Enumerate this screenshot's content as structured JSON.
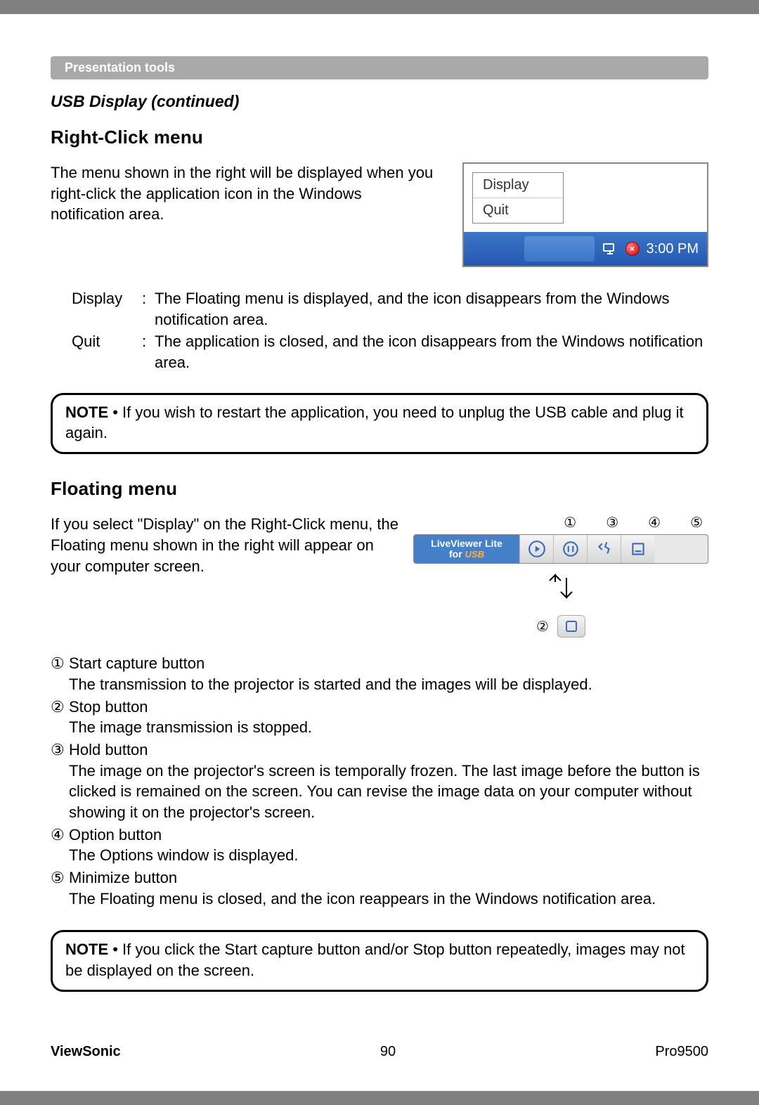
{
  "section_bar": "Presentation tools",
  "subtitle": "USB Display (continued)",
  "h1": "Right-Click menu",
  "p1": "The menu shown in the right will be displayed when you right-click the application icon in the Windows notification area.",
  "rc_menu": {
    "display": "Display",
    "quit": "Quit",
    "time": "3:00 PM"
  },
  "defs": {
    "display_term": "Display",
    "display_desc": "The Floating menu is displayed, and the icon disappears from the Windows notification area.",
    "quit_term": "Quit",
    "quit_desc": "The application is closed, and the icon disappears from the Windows notification area."
  },
  "note1_label": "NOTE",
  "note1_text": "  • If you wish to restart the application, you need to unplug the USB cable and plug it again.",
  "h2": "Floating menu",
  "p2": "If you select \"Display\" on the Right-Click menu, the Floating menu shown in the right will appear on your computer screen.",
  "callouts": {
    "c1": "①",
    "c3": "③",
    "c4": "④",
    "c5": "⑤",
    "c2": "②"
  },
  "lv_logo_line1": "LiveViewer Lite",
  "lv_logo_line2_a": "for ",
  "lv_logo_line2_b": "USB",
  "items": {
    "i1_mark": "①",
    "i1_title": "Start capture button",
    "i1_desc": "The transmission to the projector is started and the images will be displayed.",
    "i2_mark": "②",
    "i2_title": "Stop button",
    "i2_desc": "The image transmission is stopped.",
    "i3_mark": "③",
    "i3_title": "Hold button",
    "i3_desc": "The image on the projector's screen is temporally frozen. The last image before the button is clicked is remained on the screen. You can revise the image data on your computer without showing it on the projector's screen.",
    "i4_mark": "④",
    "i4_title": "Option button",
    "i4_desc": "The Options window is displayed.",
    "i5_mark": "⑤",
    "i5_title": "Minimize button",
    "i5_desc": "The Floating menu is closed, and the icon reappears in the Windows notification area."
  },
  "note2_label": "NOTE",
  "note2_text": "  • If you click the Start capture button and/or Stop button repeatedly, images may not be displayed on the screen.",
  "footer": {
    "brand": "ViewSonic",
    "page": "90",
    "model": "Pro9500"
  }
}
